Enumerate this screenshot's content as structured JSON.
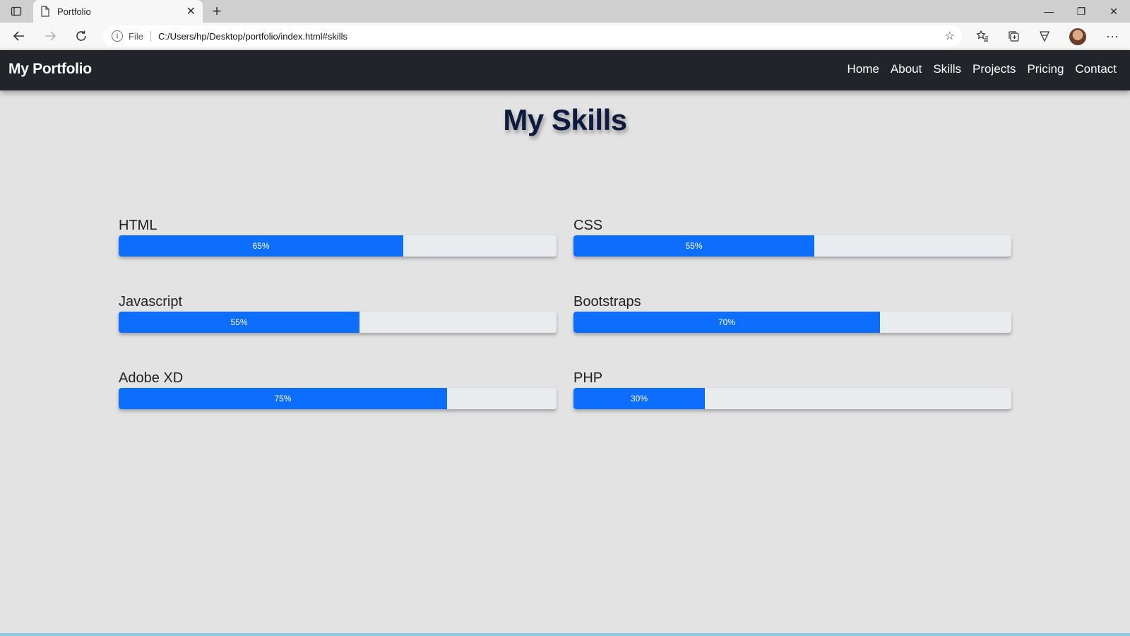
{
  "browser": {
    "tab_title": "Portfolio",
    "address_label": "File",
    "url": "C:/Users/hp/Desktop/portfolio/index.html#skills"
  },
  "site": {
    "brand": "My Portfolio",
    "nav": [
      "Home",
      "About",
      "Skills",
      "Projects",
      "Pricing",
      "Contact"
    ]
  },
  "skills_section": {
    "title": "My Skills",
    "skills": [
      {
        "name": "HTML",
        "percent": 65,
        "label": "65%"
      },
      {
        "name": "CSS",
        "percent": 55,
        "label": "55%"
      },
      {
        "name": "Javascript",
        "percent": 55,
        "label": "55%"
      },
      {
        "name": "Bootstraps",
        "percent": 70,
        "label": "70%"
      },
      {
        "name": "Adobe XD",
        "percent": 75,
        "label": "75%"
      },
      {
        "name": "PHP",
        "percent": 30,
        "label": "30%"
      }
    ]
  },
  "colors": {
    "progress_fill": "#0d6efd",
    "navbar_bg": "#212529",
    "page_bg": "#e3e3e3",
    "title_color": "#0d1b3e"
  }
}
